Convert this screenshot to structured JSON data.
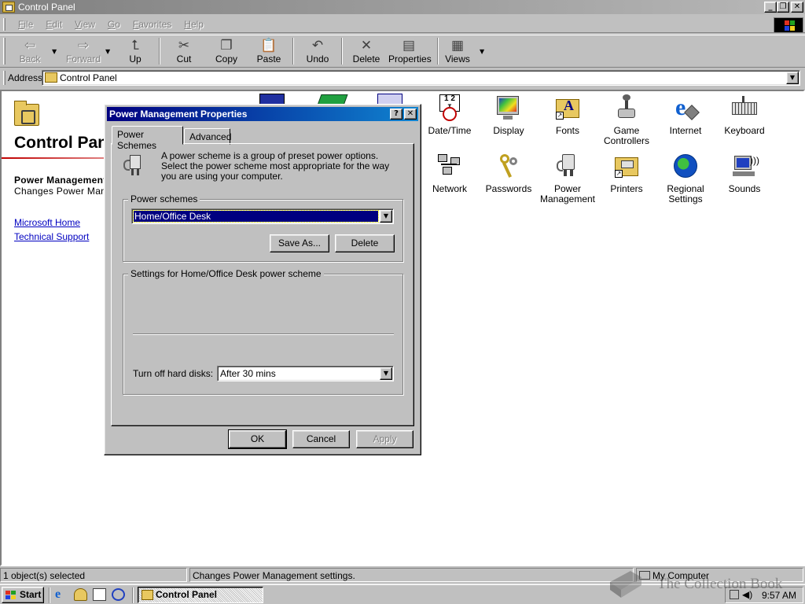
{
  "window": {
    "title": "Control Panel"
  },
  "menu": [
    {
      "label": "File",
      "key": "F",
      "rest": "ile"
    },
    {
      "label": "Edit",
      "key": "E",
      "rest": "dit"
    },
    {
      "label": "View",
      "key": "V",
      "rest": "iew"
    },
    {
      "label": "Go",
      "key": "G",
      "rest": "o"
    },
    {
      "label": "Favorites",
      "key": "F",
      "rest": "avorites"
    },
    {
      "label": "Help",
      "key": "H",
      "rest": "elp"
    }
  ],
  "toolbar": {
    "back": "Back",
    "forward": "Forward",
    "up": "Up",
    "cut": "Cut",
    "copy": "Copy",
    "paste": "Paste",
    "undo": "Undo",
    "delete": "Delete",
    "properties": "Properties",
    "views": "Views"
  },
  "address": {
    "label": "Address",
    "value": "Control Panel"
  },
  "left_pane": {
    "heading": "Control Panel",
    "selected_name": "Power Management",
    "selected_desc": "Changes Power Management settings.",
    "links": [
      "Microsoft Home",
      "Technical Support"
    ]
  },
  "icons": [
    {
      "label_lines": [
        "Date/Time"
      ]
    },
    {
      "label_lines": [
        "Display"
      ]
    },
    {
      "label_lines": [
        "Fonts"
      ]
    },
    {
      "label_lines": [
        "Game",
        "Controllers"
      ]
    },
    {
      "label_lines": [
        "Internet"
      ]
    },
    {
      "label_lines": [
        "Keyboard"
      ]
    },
    {
      "label_lines": [
        "Network"
      ]
    },
    {
      "label_lines": [
        "Passwords"
      ]
    },
    {
      "label_lines": [
        "Power",
        "Management"
      ]
    },
    {
      "label_lines": [
        "Printers"
      ]
    },
    {
      "label_lines": [
        "Regional",
        "Settings"
      ]
    },
    {
      "label_lines": [
        "Sounds"
      ]
    }
  ],
  "dialog": {
    "title": "Power Management Properties",
    "tabs": [
      "Power Schemes",
      "Advanced"
    ],
    "intro": "A power scheme is a group of preset power options. Select the power scheme most appropriate for the way you are using your computer.",
    "schemes_group": "Power schemes",
    "scheme_value": "Home/Office Desk",
    "save_as": "Save As...",
    "delete": "Delete",
    "settings_group": "Settings for Home/Office Desk power scheme",
    "hard_disk_label": "Turn off hard disks:",
    "hard_disk_value": "After 30 mins",
    "ok": "OK",
    "cancel": "Cancel",
    "apply": "Apply"
  },
  "status": {
    "objects": "1 object(s) selected",
    "description": "Changes Power Management settings.",
    "zone": "My Computer"
  },
  "taskbar": {
    "start": "Start",
    "task": "Control Panel",
    "clock": "9:57 AM"
  },
  "watermark": "The Collection Book"
}
